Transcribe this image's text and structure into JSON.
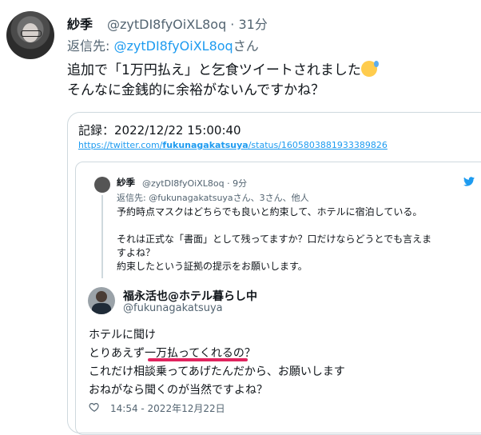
{
  "tweet": {
    "display_name": "紗季",
    "handle_time": "@zytDI8fyOiXL8oq · 31分",
    "reply_label": "返信先: ",
    "reply_handle": "@zytDI8fyOiXL8oq",
    "reply_suffix": "さん",
    "line1": "追加で「1万円払え」と乞食ツイートされました",
    "line2": "そんなに金銭的に余裕がないんですかね？",
    "emoji": "sweat-smile-emoji"
  },
  "card": {
    "record": "記録：2022/12/22 15:00:40",
    "url_prefix": "https://twitter.com/",
    "url_bold": "fukunagakatsuya",
    "url_suffix": "/status/1605803881933389826"
  },
  "quoted_reply": {
    "name": "紗季",
    "handle_time": "@zytDI8fyOiXL8oq · 9分",
    "reply_to": "返信先: @fukunagakatsuyaさん、3さん、他人",
    "line1": "予約時点マスクはどちらでも良いと約束して、ホテルに宿泊している。",
    "line2": "それは正式な「書面」として残ってますか？口だけならどうとでも言えま",
    "line3": "すよね？",
    "line4": "約束したという証拠の提示をお願いします。"
  },
  "quoted_main": {
    "name": "福永活也@ホテル暮らし中",
    "handle": "@fukunagakatsuya",
    "line1": "ホテルに聞け",
    "line2": "とりあえず一万払ってくれるの？",
    "line3": "これだけ相談乗ってあげたんだから、お願いします",
    "line4": "おねがなら聞くのが当然ですよね？",
    "timestamp": "14:54 - 2022年12月22日"
  },
  "colors": {
    "link": "#1d9bf0",
    "underline": "#e0245e",
    "muted": "#536471"
  },
  "icons": [
    "twitter-bird-icon",
    "heart-icon"
  ]
}
